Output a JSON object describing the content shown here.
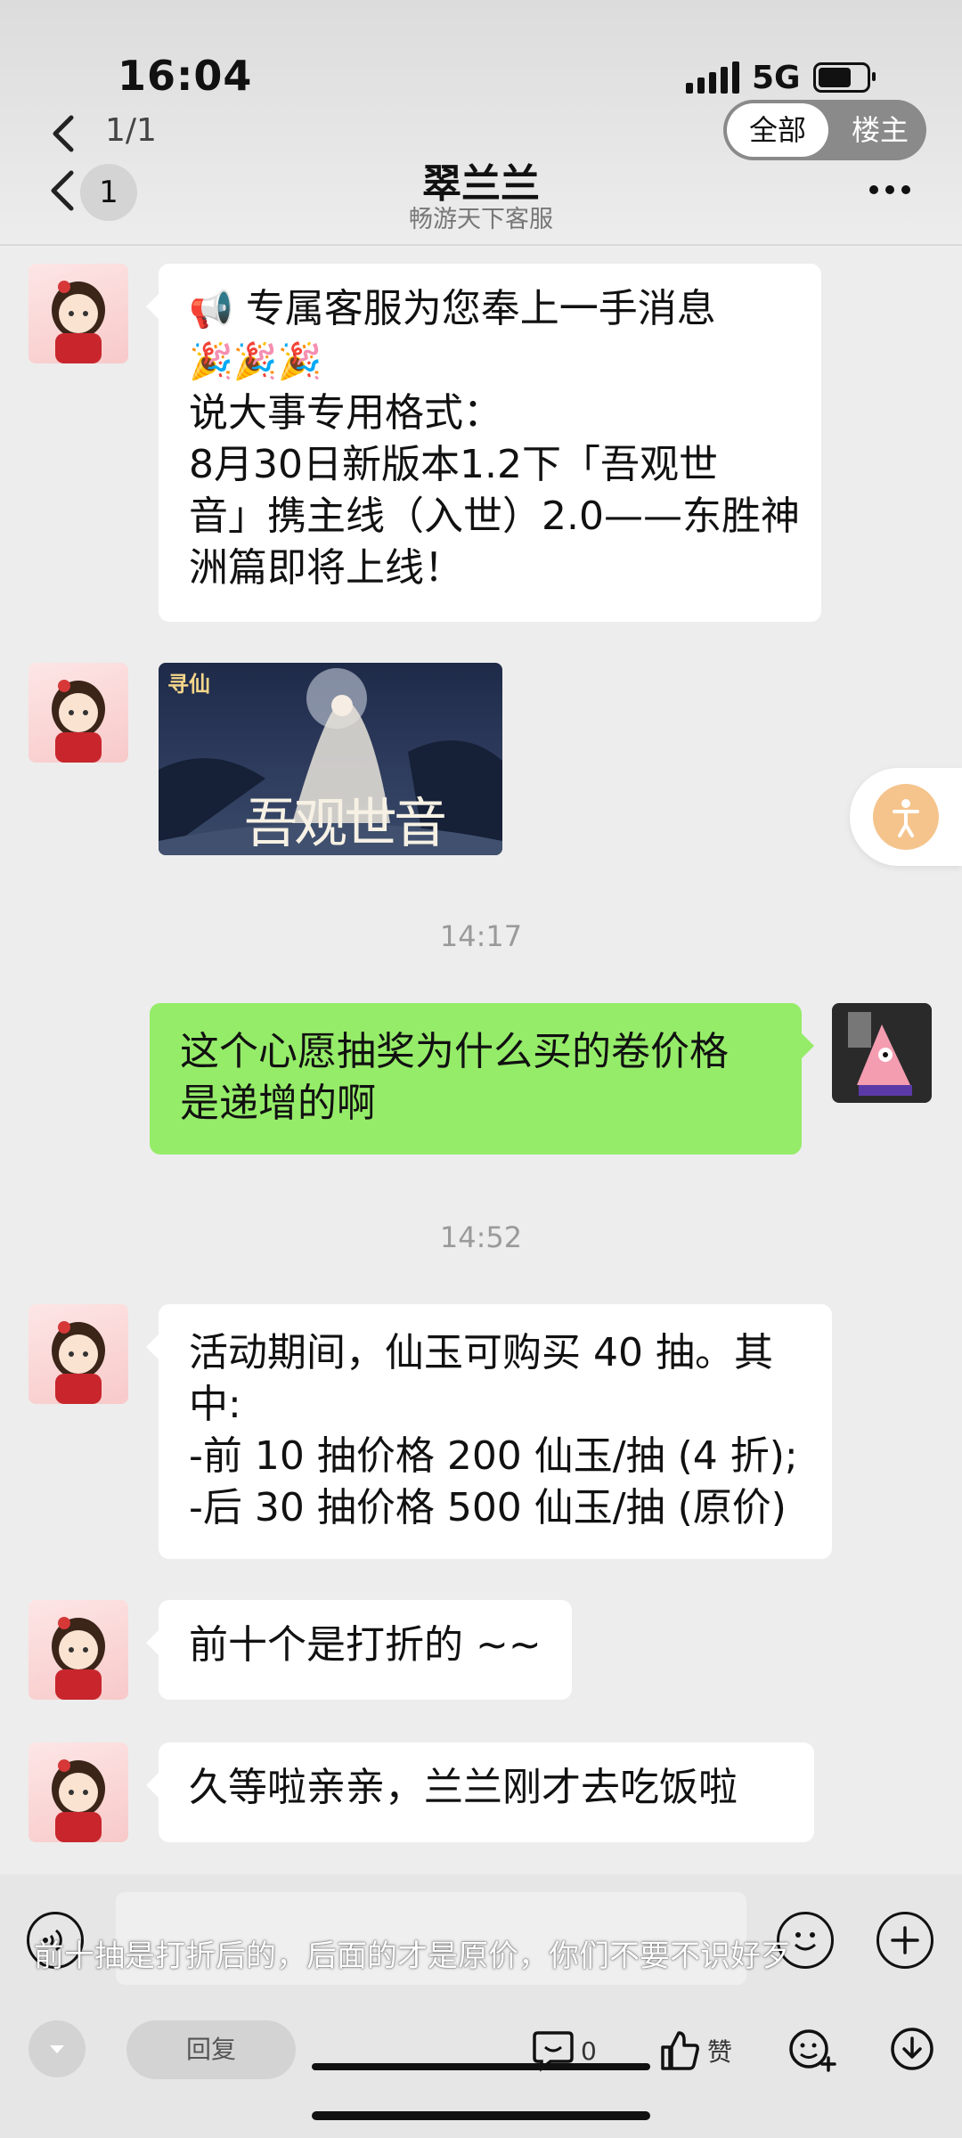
{
  "status_bar": {
    "time": "16:04",
    "network": "5G"
  },
  "nav": {
    "pager": "1/1",
    "filter": {
      "all": "全部",
      "owner": "楼主"
    },
    "unread_count": "1",
    "title": "翠兰兰",
    "subtitle": "畅游天下客服"
  },
  "messages": {
    "m1": {
      "lines": [
        "专属客服为您奉上一手消息",
        "说大事专用格式：",
        "8月30日新版本1.2下「吾观世",
        "音」携主线（入世）2.0——东胜神",
        "洲篇即将上线！"
      ],
      "emoji_megaphone": "📢",
      "emoji_party": "🎉🎉🎉"
    },
    "img_banner": {
      "logo": "寻仙",
      "calligraphy": "吾观世音"
    },
    "t1": "14:17",
    "m_user": {
      "lines": [
        "这个心愿抽奖为什么买的卷价格",
        "是递增的啊"
      ]
    },
    "t2": "14:52",
    "m2": {
      "lines": [
        "活动期间，仙玉可购买 40 抽。其",
        "中:",
        "-前 10 抽价格 200 仙玉/抽 (4 折);",
        "-后 30 抽价格 500 仙玉/抽 (原价)"
      ]
    },
    "m3": {
      "text": "前十个是打折的 ~~"
    },
    "m4": {
      "text": "久等啦亲亲，兰兰刚才去吃饭啦"
    }
  },
  "video_caption": "前十抽是打折后的，后面的才是原价，你们不要不识好歹",
  "bottom_bar": {
    "reply": "回复",
    "comment_count": "0",
    "like_label": "赞"
  },
  "colors": {
    "bubble_user": "#95ec69",
    "bubble_other": "#ffffff",
    "background": "#ededed"
  }
}
